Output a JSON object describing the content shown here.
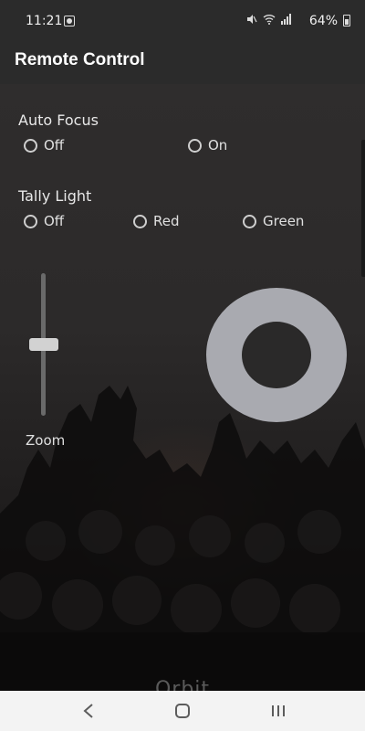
{
  "status_bar": {
    "time": "11:21",
    "battery": "64%",
    "icons": [
      "camera-notification-icon",
      "mute-icon",
      "wifi-icon",
      "signal-icon",
      "battery-icon"
    ]
  },
  "app_bar": {
    "title": "Remote Control"
  },
  "auto_focus": {
    "label": "Auto Focus",
    "options": [
      "Off",
      "On"
    ]
  },
  "tally_light": {
    "label": "Tally Light",
    "options": [
      "Off",
      "Red",
      "Green"
    ]
  },
  "zoom": {
    "label": "Zoom",
    "level_fraction": 0.5
  },
  "joystick": {
    "ring_color": "#a9aab0",
    "center_color": "#2a2929"
  },
  "watermark": "Orbit",
  "nav_bar": {
    "buttons": [
      "back-icon",
      "home-icon",
      "recents-icon"
    ]
  },
  "colors": {
    "app_bar": "#2b2b2b",
    "nav_bar": "#f3f3f3"
  }
}
